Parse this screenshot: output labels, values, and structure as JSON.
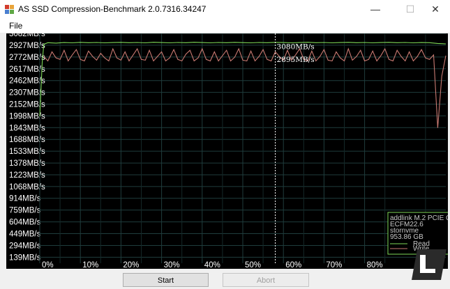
{
  "window": {
    "title": "AS SSD Compression-Benchmark 2.0.7316.34247",
    "minimize": "—",
    "maximize": "☐",
    "close": "✕"
  },
  "menu": {
    "file": "File"
  },
  "chart_data": {
    "type": "line",
    "x_unit": "% compressible",
    "y_ticks": [
      "3082MB/s",
      "2927MB/s",
      "2772MB/s",
      "2617MB/s",
      "2462MB/s",
      "2307MB/s",
      "2152MB/s",
      "1998MB/s",
      "1843MB/s",
      "1688MB/s",
      "1533MB/s",
      "1378MB/s",
      "1223MB/s",
      "1068MB/s",
      "914MB/s",
      "759MB/s",
      "604MB/s",
      "449MB/s",
      "294MB/s",
      "139MB/s"
    ],
    "y_tick_values": [
      3082,
      2927,
      2772,
      2617,
      2462,
      2307,
      2152,
      1998,
      1843,
      1688,
      1533,
      1378,
      1223,
      1068,
      914,
      759,
      604,
      449,
      294,
      139
    ],
    "x_ticks": [
      "0%",
      "10%",
      "20%",
      "30%",
      "40%",
      "50%",
      "60%",
      "70%",
      "80%"
    ],
    "x_tick_values": [
      0,
      10,
      20,
      30,
      40,
      50,
      60,
      70,
      80
    ],
    "xlim": [
      0,
      100
    ],
    "ylim": [
      60,
      3082
    ],
    "grid": true,
    "cursor": {
      "x": 58,
      "read_label": "3080MB/s",
      "write_label": "2895MB/s"
    },
    "legend_position": "bottom-right",
    "legend_lines": [
      "addlink M.2 PCIE G",
      "ECFM22.6",
      "stornvme",
      "953.86 GB"
    ],
    "series": [
      {
        "name": "Read",
        "color": "#7ed957",
        "x": [
          0,
          0.6,
          1,
          2,
          4,
          6,
          8,
          10,
          12,
          14,
          16,
          18,
          20,
          22,
          24,
          26,
          28,
          30,
          32,
          34,
          36,
          38,
          40,
          42,
          44,
          46,
          48,
          50,
          52,
          54,
          56,
          58,
          60,
          62,
          64,
          66,
          68,
          70,
          72,
          74,
          76,
          78,
          80,
          82,
          84,
          86,
          88,
          90,
          92,
          94,
          96,
          98,
          100
        ],
        "values": [
          1990,
          2700,
          2940,
          2960,
          2955,
          2962,
          2958,
          2965,
          2960,
          2963,
          2958,
          2962,
          2965,
          2960,
          2963,
          2958,
          2966,
          2962,
          2958,
          2963,
          2960,
          2966,
          2962,
          2958,
          2963,
          2960,
          2965,
          2961,
          2958,
          2963,
          2960,
          2965,
          2962,
          2958,
          2962,
          2966,
          2960,
          2963,
          2958,
          2962,
          2965,
          2960,
          2963,
          2958,
          2962,
          2965,
          2960,
          2963,
          2958,
          2962,
          2960,
          2950,
          2945
        ]
      },
      {
        "name": "Write",
        "color": "#c97a72",
        "x": [
          1,
          2,
          3,
          4,
          5,
          6,
          7,
          8,
          9,
          10,
          11,
          12,
          13,
          14,
          15,
          16,
          17,
          18,
          19,
          20,
          21,
          22,
          23,
          24,
          25,
          26,
          27,
          28,
          29,
          30,
          31,
          32,
          33,
          34,
          35,
          36,
          37,
          38,
          39,
          40,
          41,
          42,
          43,
          44,
          45,
          46,
          47,
          48,
          49,
          50,
          51,
          52,
          53,
          54,
          55,
          56,
          57,
          58,
          59,
          60,
          61,
          62,
          63,
          64,
          65,
          66,
          67,
          68,
          69,
          70,
          71,
          72,
          73,
          74,
          75,
          76,
          77,
          78,
          79,
          80,
          81,
          82,
          83,
          84,
          85,
          86,
          87,
          88,
          89,
          90,
          91,
          92,
          93,
          94,
          95,
          96,
          97,
          98,
          99,
          100
        ],
        "values": [
          2780,
          2720,
          2840,
          2760,
          2740,
          2860,
          2720,
          2800,
          2870,
          2740,
          2720,
          2850,
          2780,
          2730,
          2820,
          2760,
          2720,
          2880,
          2760,
          2730,
          2840,
          2720,
          2800,
          2880,
          2740,
          2730,
          2860,
          2720,
          2780,
          2840,
          2720,
          2760,
          2870,
          2740,
          2720,
          2810,
          2860,
          2720,
          2760,
          2880,
          2740,
          2720,
          2840,
          2720,
          2790,
          2860,
          2720,
          2770,
          2880,
          2730,
          2720,
          2850,
          2720,
          2780,
          2870,
          2740,
          2720,
          2840,
          2780,
          2730,
          2860,
          2730,
          2800,
          2880,
          2740,
          2720,
          2850,
          2720,
          2780,
          2870,
          2730,
          2720,
          2840,
          2760,
          2720,
          2880,
          2730,
          2780,
          2860,
          2720,
          2740,
          2850,
          2720,
          2790,
          2880,
          2740,
          2720,
          2860,
          2780,
          2720,
          2840,
          2720,
          2780,
          2870,
          2760,
          2740,
          2800,
          1840,
          2520,
          2790
        ]
      }
    ]
  },
  "buttons": {
    "start": "Start",
    "abort": "Abort"
  }
}
